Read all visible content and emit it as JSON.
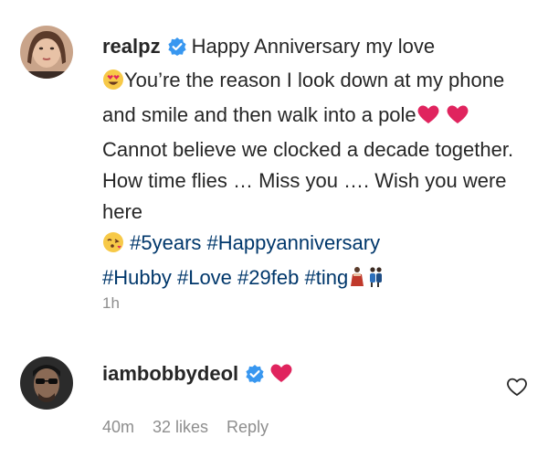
{
  "post": {
    "username": "realpz",
    "caption_parts": {
      "p1": "Happy Anniversary my love",
      "p2": "You’re the reason I look down at my phone and smile and then walk into a pole",
      "p3": " Cannot believe we clocked a decade together. How time flies … Miss you …. Wish you were here ",
      "p4": " "
    },
    "hashtags": [
      "#5years",
      "#Happyanniversary",
      "#Hubby",
      "#Love",
      "#29feb",
      "#ting"
    ],
    "time": "1h"
  },
  "reply": {
    "username": "iambobbydeol",
    "time": "40m",
    "likes": "32 likes",
    "reply_label": "Reply"
  },
  "colors": {
    "text": "#262626",
    "muted": "#8e8e8e",
    "hashtag": "#00376b",
    "verified": "#3897f0",
    "heart": "#e0245e"
  },
  "icons": {
    "verified": "verified-badge-icon",
    "heart_eyes": "heart-eyes-emoji-icon",
    "red_heart": "red-heart-emoji-icon",
    "kiss": "face-blowing-kiss-emoji-icon",
    "dancers": "dancer-emoji-icon",
    "people": "people-walking-emoji-icon",
    "like": "heart-outline-icon"
  }
}
